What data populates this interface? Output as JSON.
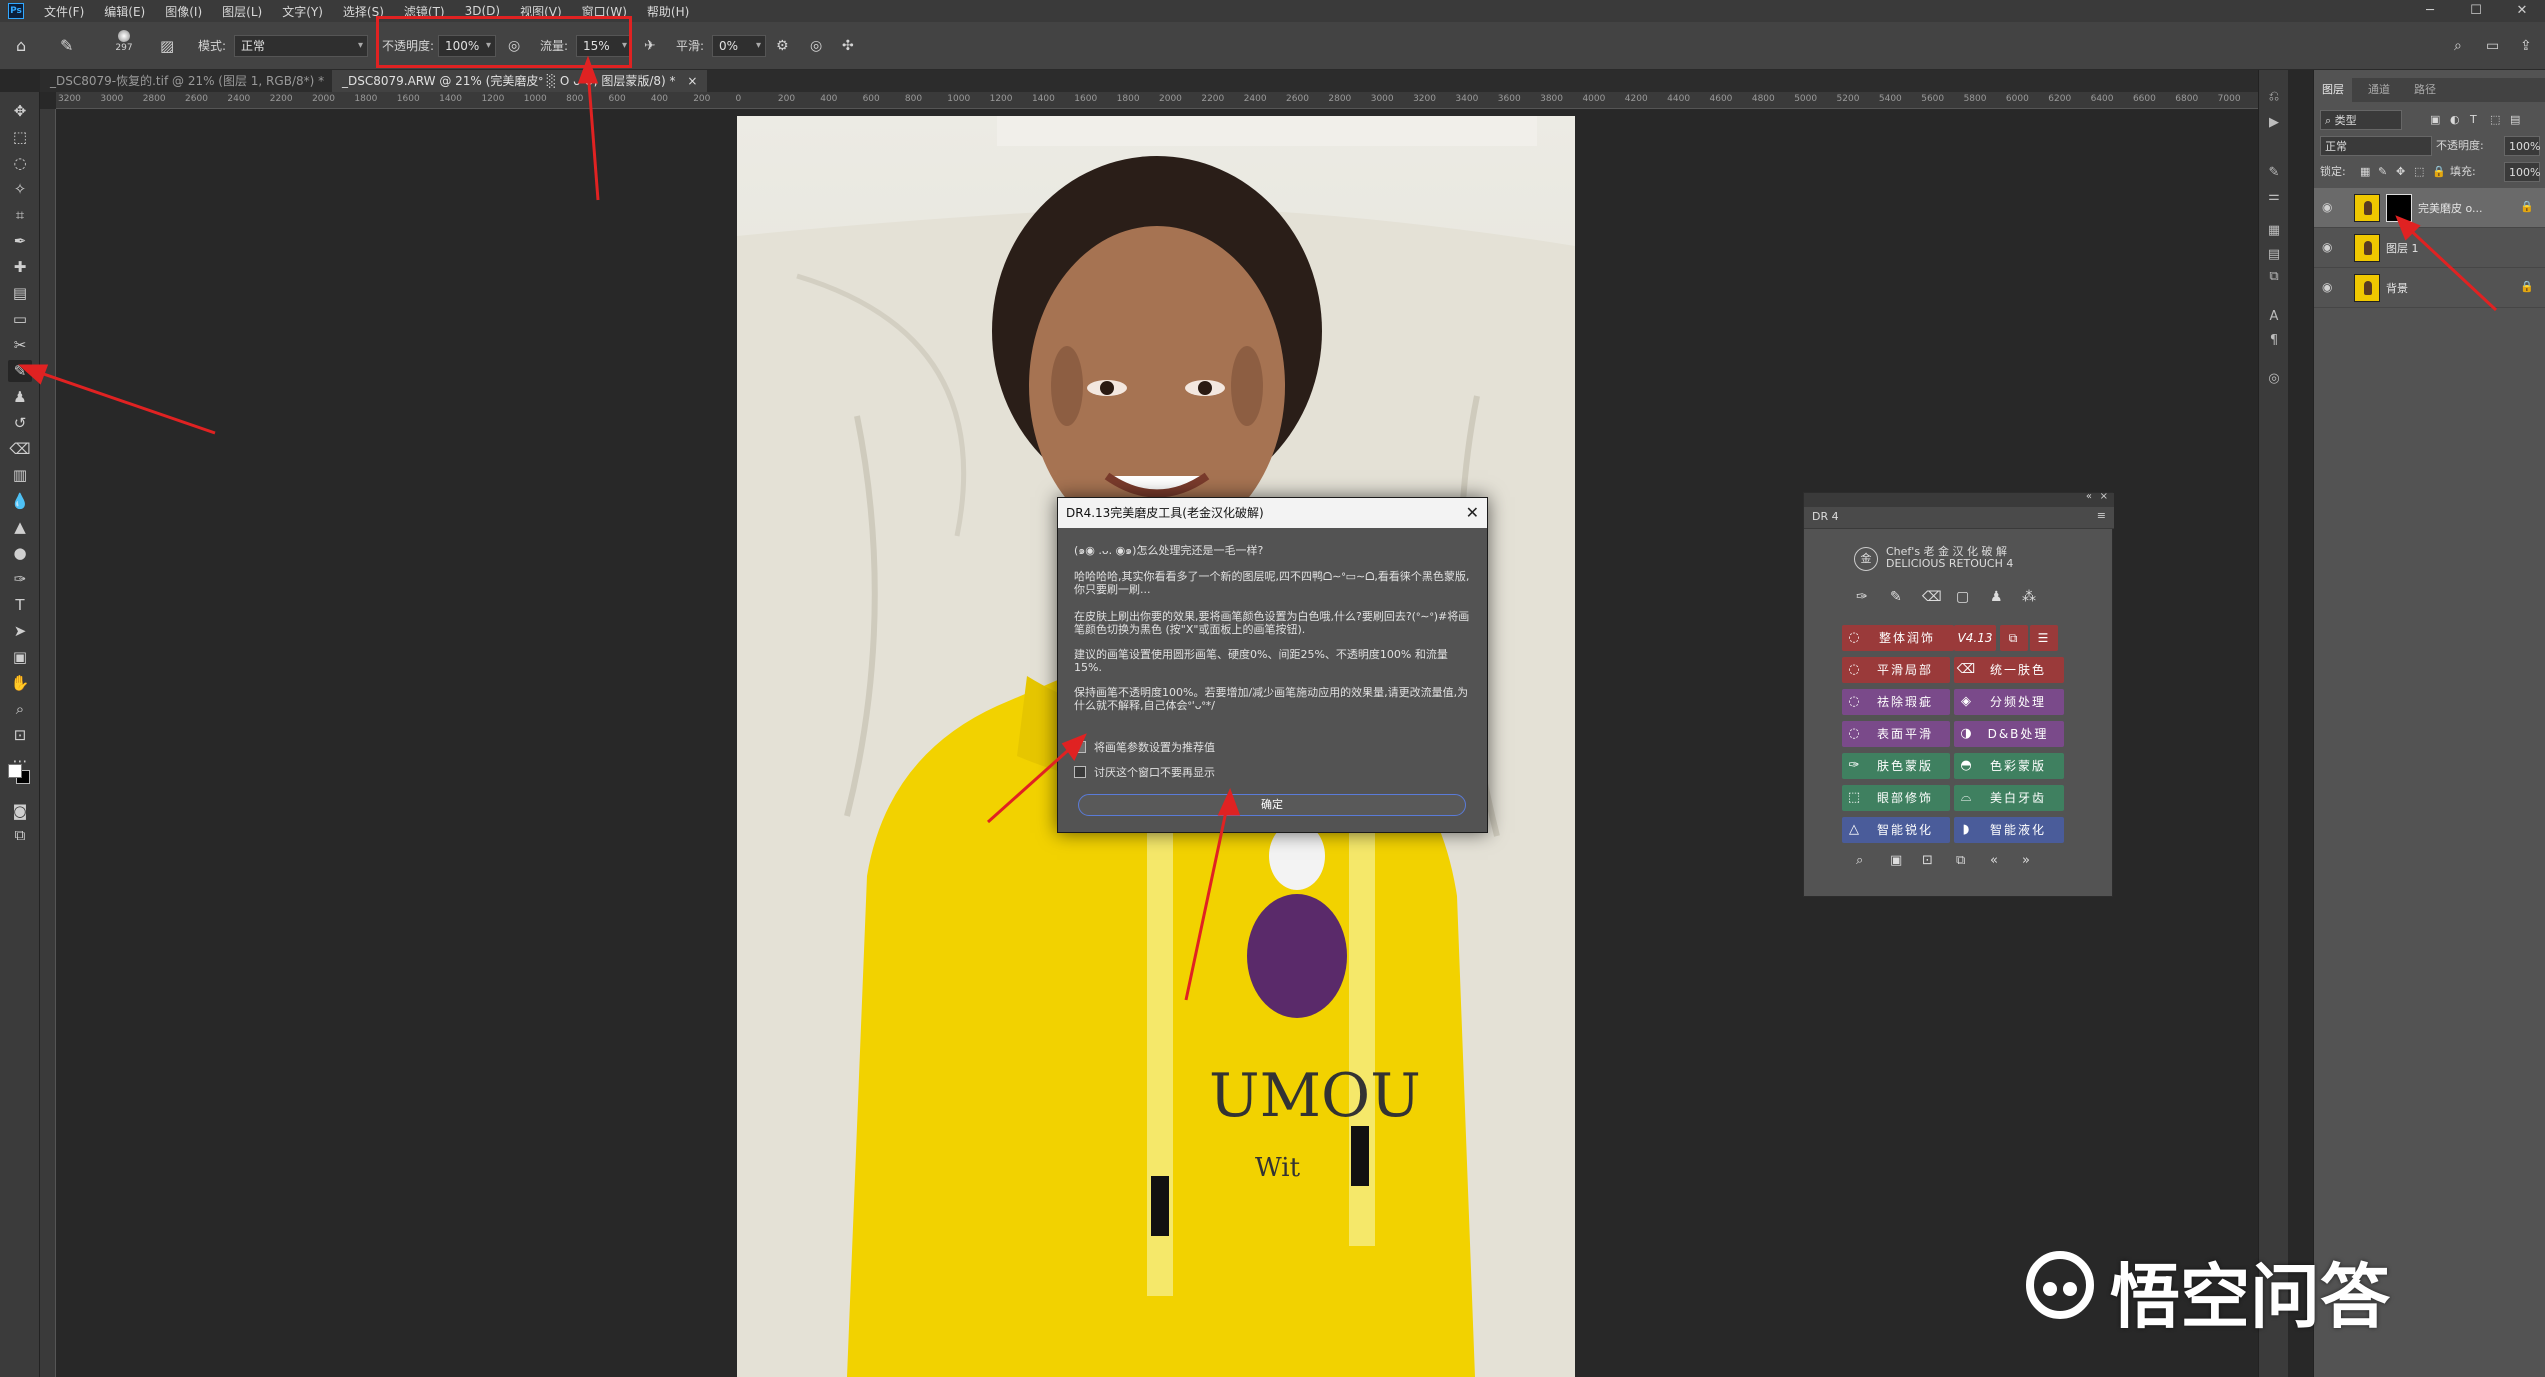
{
  "menubar": {
    "app_icon": "Ps",
    "items": [
      "文件(F)",
      "编辑(E)",
      "图像(I)",
      "图层(L)",
      "文字(Y)",
      "选择(S)",
      "滤镜(T)",
      "3D(D)",
      "视图(V)",
      "窗口(W)",
      "帮助(H)"
    ]
  },
  "options": {
    "brush_size": "297",
    "mode_label": "模式:",
    "mode_value": "正常",
    "opacity_label": "不透明度:",
    "opacity_value": "100%",
    "flow_label": "流量:",
    "flow_value": "15%",
    "smoothing_label": "平滑:",
    "smoothing_value": "0%"
  },
  "tabs": [
    {
      "label": "_DSC8079-恢复的.tif @ 21% (图层 1, RGB/8*) *"
    },
    {
      "label": "_DSC8079.ARW @ 21% (完美磨皮ᐤ ░ O ᴗ O, 图层蒙版/8) *"
    }
  ],
  "ruler": {
    "ticks": [
      "3200",
      "3000",
      "2800",
      "2600",
      "2400",
      "2200",
      "2000",
      "1800",
      "1600",
      "1400",
      "1200",
      "1000",
      "800",
      "600",
      "400",
      "200",
      "0",
      "200",
      "400",
      "600",
      "800",
      "1000",
      "1200",
      "1400",
      "1600",
      "1800",
      "2000",
      "2200",
      "2400",
      "2600",
      "2800",
      "3000",
      "3200",
      "3400",
      "3600",
      "3800",
      "4000",
      "4200",
      "4400",
      "4600",
      "4800",
      "5000",
      "5200",
      "5400",
      "5600",
      "5800",
      "6000",
      "6200",
      "6400",
      "6600",
      "6800",
      "7000"
    ]
  },
  "layers_panel": {
    "tabs": [
      "图层",
      "通道",
      "路径"
    ],
    "filter_label": "类型",
    "blend_mode": "正常",
    "opacity_label": "不透明度:",
    "opacity_value": "100%",
    "lock_label": "锁定:",
    "fill_label": "填充:",
    "fill_value": "100%",
    "layers": [
      {
        "name": "完美磨皮 o...",
        "selected": true,
        "has_mask": true
      },
      {
        "name": "图层 1",
        "selected": false,
        "has_mask": false
      },
      {
        "name": "背景",
        "selected": false,
        "has_mask": false,
        "locked": true
      }
    ]
  },
  "dr4": {
    "tab": "DR 4",
    "brand_line1": "Chef's 老 金 汉 化 破 解",
    "brand_line2": "DELICIOUS RETOUCH 4",
    "buttons_left": [
      "整体润饰",
      "平滑局部",
      "祛除瑕疵",
      "表面平滑",
      "肤色蒙版",
      "眼部修饰",
      "智能锐化"
    ],
    "buttons_right": [
      "统一肤色",
      "分频处理",
      "D&B处理",
      "色彩蒙版",
      "美白牙齿",
      "智能液化"
    ],
    "version": "V4.13"
  },
  "dialog": {
    "title": "DR4.13完美磨皮工具(老金汉化破解)",
    "line1": "(๑◉ .ᴗ. ◉๑)怎么处理完还是一毛一样?",
    "para1": "哈哈哈哈,其实你看看多了一个新的图层呢,四不四鸭ᗝ∼ᐤ▭∼ᗝ,看看徕个黑色蒙版,你只要刷一刷...",
    "para2": "在皮肤上刷出你要的效果,要将画笔颜色设置为白色哦,什么?要刷回去?(ᐤ∼ᐤ)#将画笔颜色切换为黑色 (按\"X\"或面板上的画笔按钮).",
    "para3": "建议的画笔设置使用圆形画笔、硬度0%、间距25%、不透明度100% 和流量15%.",
    "para4": "保持画笔不透明度100%。若要增加/减少画笔施动应用的效果量,请更改流量值,为什么就不解释,自己体会ᐤ'ᴗᐤ*/",
    "checkbox1": "将画笔参数设置为推荐值",
    "checkbox2": "讨厌这个窗口不要再显示",
    "ok_label": "确定"
  },
  "watermark": {
    "text": "悟空问答"
  },
  "colors": {
    "highlight_red": "#e02222",
    "hoodie_yellow": "#f2d200",
    "dr4_red": "#9a3a3a",
    "dr4_purple": "#7a4a8a",
    "dr4_green": "#3f8060",
    "dr4_blue": "#4a5c9a"
  }
}
